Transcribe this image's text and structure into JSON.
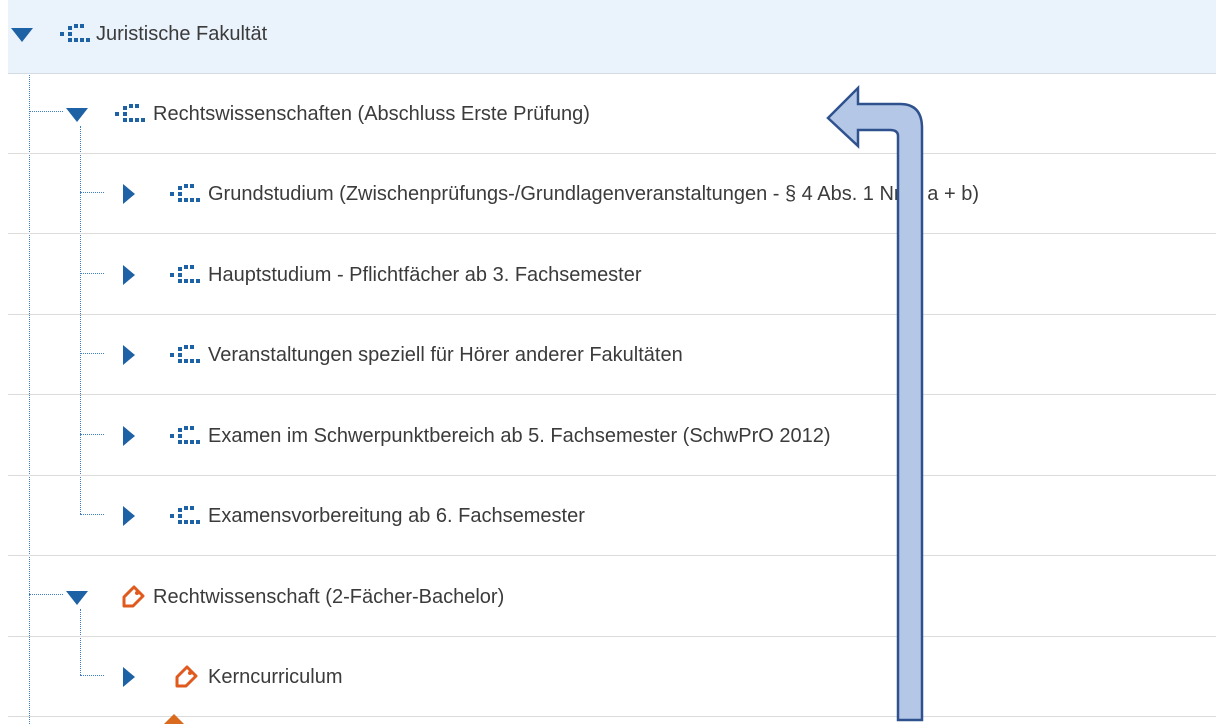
{
  "colors": {
    "accent": "#1e62a6",
    "node_icon": "#1e62a6",
    "tag_icon": "#e05a1e",
    "selected_row_bg": "#eaf2fb",
    "overlay_arrow_fill": "#b4c7e7",
    "overlay_arrow_stroke": "#2f528f"
  },
  "tree": {
    "rows": [
      {
        "label": "Juristische Fakultät",
        "expanded": true,
        "icon": "structure-grid-icon",
        "level": 0,
        "selected": true
      },
      {
        "label": "Rechtswissenschaften (Abschluss Erste Prüfung)",
        "expanded": true,
        "icon": "structure-grid-icon",
        "level": 1
      },
      {
        "label": "Grundstudium (Zwischenprüfungs-/Grundlagenveranstaltungen - § 4 Abs. 1 Nr. 1 a + b)",
        "expanded": false,
        "icon": "structure-grid-icon",
        "level": 2
      },
      {
        "label": "Hauptstudium - Pflichtfächer ab 3. Fachsemester",
        "expanded": false,
        "icon": "structure-grid-icon",
        "level": 2
      },
      {
        "label": "Veranstaltungen speziell für Hörer anderer Fakultäten",
        "expanded": false,
        "icon": "structure-grid-icon",
        "level": 2
      },
      {
        "label": "Examen im Schwerpunktbereich ab 5. Fachsemester (SchwPrO 2012)",
        "expanded": false,
        "icon": "structure-grid-icon",
        "level": 2
      },
      {
        "label": "Examensvorbereitung ab 6. Fachsemester",
        "expanded": false,
        "icon": "structure-grid-icon",
        "level": 2
      },
      {
        "label": "Rechtwissenschaft (2-Fächer-Bachelor)",
        "expanded": true,
        "icon": "tag-icon",
        "level": 1
      },
      {
        "label": "Kerncurriculum",
        "expanded": false,
        "icon": "tag-icon",
        "level": 2
      }
    ]
  },
  "overlay": {
    "icon": "up-left-arrow-icon"
  }
}
